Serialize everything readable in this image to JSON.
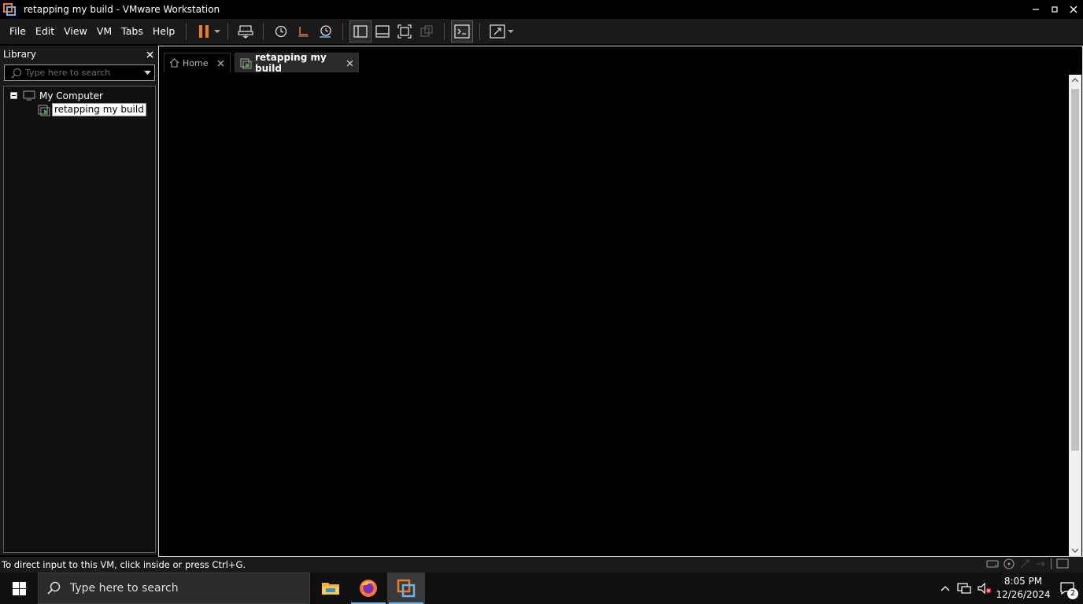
{
  "window": {
    "title": "retapping my build - VMware Workstation"
  },
  "menubar": {
    "items": [
      "File",
      "Edit",
      "View",
      "VM",
      "Tabs",
      "Help"
    ]
  },
  "toolbar": {
    "icons": [
      "pause-icon",
      "send-ctrl-alt-del-icon",
      "snapshot-icon",
      "revert-snapshot-icon",
      "snapshot-manager-icon",
      "show-library-icon",
      "thumbnail-bar-icon",
      "full-screen-icon",
      "unity-icon",
      "console-view-icon",
      "stretch-guest-icon"
    ],
    "colors": {
      "pause": "#f47a20",
      "active_border": "#5a5a5a"
    }
  },
  "library": {
    "title": "Library",
    "search_placeholder": "Type here to search",
    "tree": {
      "root": "My Computer",
      "vm": "retapping my build"
    }
  },
  "tabs": [
    {
      "label": "Home",
      "active": false
    },
    {
      "label": "retapping my build",
      "active": true
    }
  ],
  "statusbar": {
    "message": "To direct input to this VM, click inside or press Ctrl+G."
  },
  "taskbar": {
    "search_placeholder": "Type here to search",
    "apps": [
      "file-explorer-icon",
      "firefox-icon",
      "vmware-workstation-icon"
    ],
    "time": "8:05 PM",
    "date": "12/26/2024",
    "notification_count": "2"
  },
  "colors": {
    "accent": "#6cb2eb",
    "brand_orange": "#f47a20",
    "vm_green": "#3ea83e"
  }
}
